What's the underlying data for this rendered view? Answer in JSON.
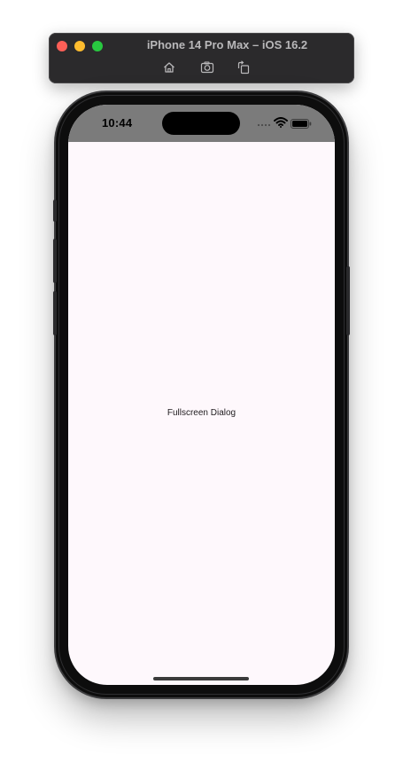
{
  "simulator": {
    "title": "iPhone 14 Pro Max – iOS 16.2",
    "toolbar": [
      {
        "name": "home",
        "icon": "home-icon"
      },
      {
        "name": "screenshot",
        "icon": "camera-icon"
      },
      {
        "name": "rotate",
        "icon": "rotate-icon"
      }
    ]
  },
  "device": {
    "status_bar": {
      "time": "10:44",
      "wifi_icon": "wifi-icon",
      "battery_icon": "battery-icon"
    },
    "screen": {
      "content_text": "Fullscreen Dialog",
      "background": "#fef8fc"
    }
  },
  "colors": {
    "window_chrome": "#2b2a2c",
    "close": "#fe5f57",
    "minimize": "#febc2e",
    "maximize": "#28c840",
    "status_bar": "#7b7b7b"
  }
}
